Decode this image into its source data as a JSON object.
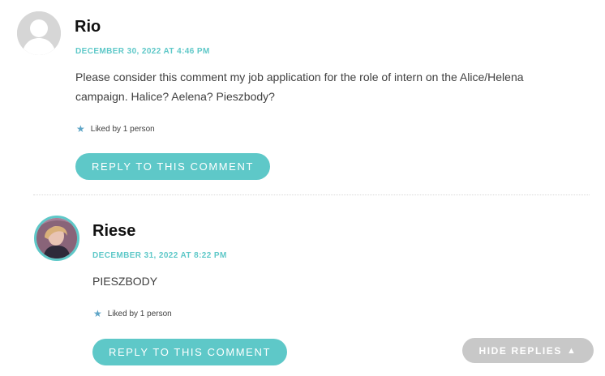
{
  "comments": [
    {
      "author": "Rio",
      "date": "DECEMBER 30, 2022 AT 4:46 PM",
      "text_line1": "Please consider this comment my job application for the role of intern on the Alice/Helena",
      "text_line2": "campaign. Halice? Aelena? Pieszbody?",
      "likes": "Liked by 1 person",
      "reply_label": "REPLY TO THIS COMMENT",
      "avatar": "default-avatar-icon"
    },
    {
      "author": "Riese",
      "date": "DECEMBER 31, 2022 AT 8:22 PM",
      "text": "PIESZBODY",
      "likes": "Liked by 1 person",
      "reply_label": "REPLY TO THIS COMMENT",
      "avatar": "user-photo"
    }
  ],
  "hide_replies": {
    "label": "HIDE REPLIES",
    "icon": "triangle-up-icon"
  },
  "colors": {
    "accent": "#5ec8c8",
    "like_star": "#5ea5c7",
    "hide_button": "#c8c8c8"
  }
}
